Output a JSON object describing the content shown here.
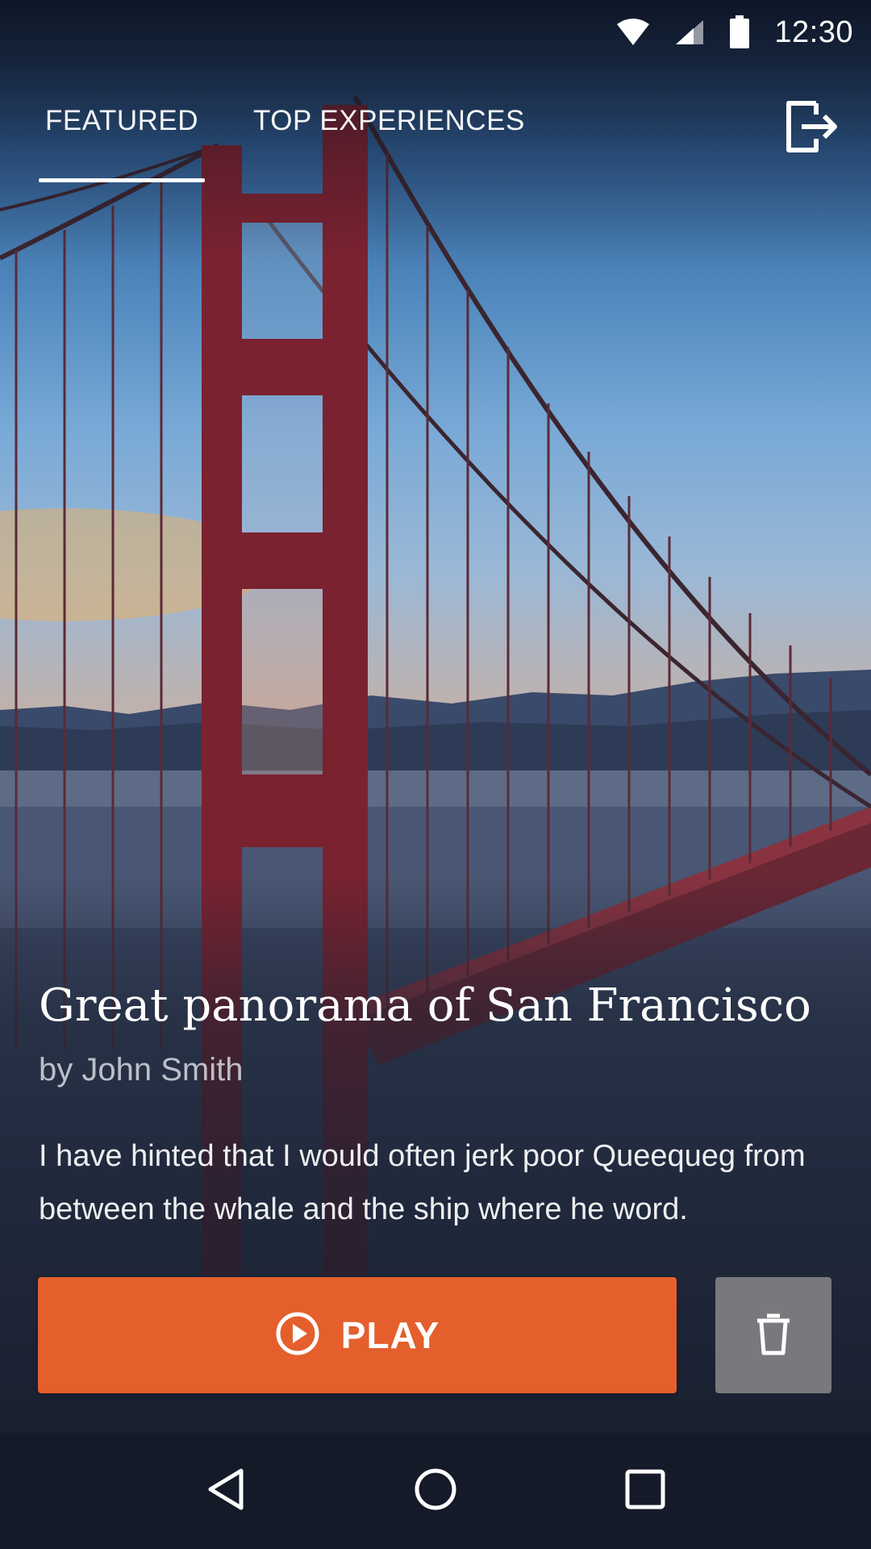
{
  "status_bar": {
    "time": "12:30",
    "icons": [
      "wifi-icon",
      "cellular-signal-icon",
      "battery-icon"
    ]
  },
  "tabs": [
    {
      "label": "FEATURED",
      "active": true
    },
    {
      "label": "TOP EXPERIENCES",
      "active": false
    }
  ],
  "header": {
    "exit_icon": "exit-icon"
  },
  "experience": {
    "title": "Great panorama of San Francisco",
    "author": "by John Smith",
    "description": "I have hinted that I would often jerk poor Queequeg from between the whale and the ship where he word."
  },
  "actions": {
    "play_label": "PLAY",
    "play_icon": "play-circle-icon",
    "delete_icon": "trash-icon"
  },
  "nav": {
    "icons": [
      "back-icon",
      "home-icon",
      "recents-icon"
    ]
  },
  "colors": {
    "accent": "#e45f2c",
    "nav_background": "#141a27",
    "delete_button": "#8c8c8c"
  }
}
